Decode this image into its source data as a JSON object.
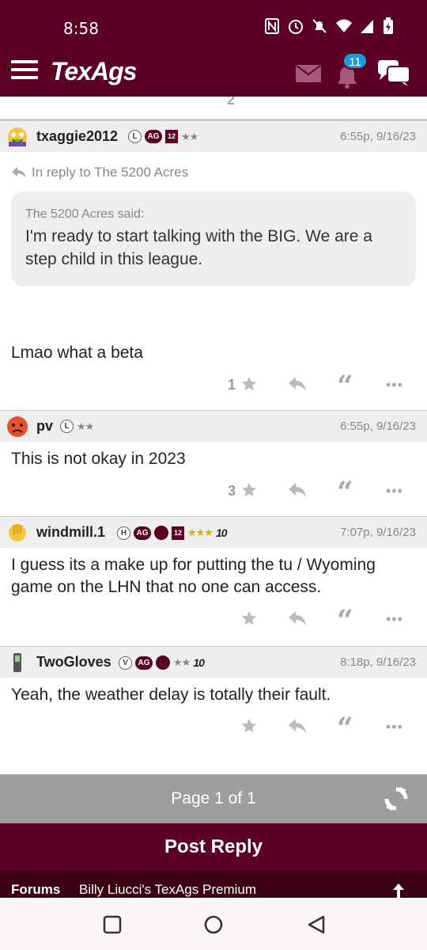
{
  "status": {
    "time": "8:58"
  },
  "appbar": {
    "logo": "TexAgs",
    "notification_count": "11"
  },
  "partial": {
    "star_count": "2"
  },
  "posts": [
    {
      "username": "txaggie2012",
      "badges": [
        "L",
        "AG",
        "12"
      ],
      "stars": "★★",
      "timestamp": "6:55p, 9/16/23",
      "in_reply": "In reply to The 5200 Acres",
      "quote_author": "The 5200 Acres said:",
      "quote_text": "I'm ready to start talking with the BIG. We are a step child in this league.",
      "text": "Lmao what a beta",
      "star_count": "1"
    },
    {
      "username": "pv",
      "badges": [
        "L"
      ],
      "stars": "★★",
      "timestamp": "6:55p, 9/16/23",
      "text": "This is not okay in 2023",
      "star_count": "3"
    },
    {
      "username": "windmill.1",
      "badges": [
        "H",
        "AG",
        "12"
      ],
      "stars": "★★★",
      "tenure": "10",
      "timestamp": "7:07p, 9/16/23",
      "text": "I guess its a make up for putting the tu / Wyoming game on the LHN that no one can access.",
      "star_count": ""
    },
    {
      "username": "TwoGloves",
      "badges": [
        "V",
        "AG"
      ],
      "stars": "★★",
      "tenure": "10",
      "timestamp": "8:18p, 9/16/23",
      "text": "Yeah, the weather delay is totally their fault.",
      "star_count": ""
    }
  ],
  "pager": {
    "label": "Page 1 of 1"
  },
  "post_reply": {
    "label": "Post Reply"
  },
  "footer": {
    "label": "Forums",
    "link": "Billy Liucci's TexAgs Premium"
  },
  "colors": {
    "brand": "#5d0025",
    "badge": "#1e9bd7",
    "pager": "#9e9e9e",
    "gold_star": "#d4b000"
  },
  "icons": [
    "menu-icon",
    "mail-icon",
    "bell-icon",
    "chat-icon",
    "star-icon",
    "reply-icon",
    "quote-icon",
    "more-icon",
    "refresh-icon",
    "up-arrow-icon"
  ]
}
